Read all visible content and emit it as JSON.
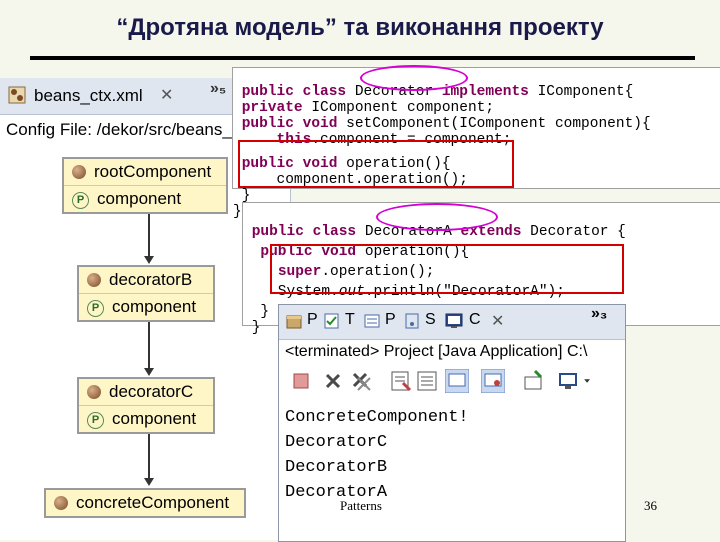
{
  "slide": {
    "title": "“Дротяна модель” та виконання проекту",
    "footer_left": "Patterns",
    "page_number": "36"
  },
  "beans_editor": {
    "tab_label": "beans_ctx.xml",
    "tab_close": "✕",
    "tab_overflow": "»₅",
    "config_file": "Config File: /dekor/src/beans_ctx.xml",
    "nodes": [
      {
        "bean": "rootComponent",
        "property": "component"
      },
      {
        "bean": "decoratorB",
        "property": "component"
      },
      {
        "bean": "decoratorC",
        "property": "component"
      },
      {
        "bean": "concreteComponent",
        "property": ""
      }
    ],
    "property_badge": "P"
  },
  "code1": {
    "lines": [
      [
        "public class ",
        "Decorator",
        " implements IComponent{"
      ],
      [
        " private IComponent component;"
      ],
      [
        " public void setComponent(IComponent component){"
      ],
      [
        "     this.component = component;"
      ],
      [
        " public void operation(){"
      ],
      [
        "     component.operation();"
      ],
      [
        " }"
      ],
      [
        "}"
      ]
    ]
  },
  "code2": {
    "lines": [
      "public class DecoratorA extends Decorator {",
      " public void operation(){",
      "     super.operation();",
      "     System.out.println(\"DecoratorA\");",
      " }",
      "}"
    ]
  },
  "console": {
    "tabs": [
      "P",
      "T",
      "P",
      "S",
      "C"
    ],
    "tab_close": "✕",
    "tab_overflow": "»₃",
    "status": "<terminated> Project [Java Application] C:\\",
    "output": [
      "ConcreteComponent!",
      "DecoratorC",
      "DecoratorB",
      "DecoratorA"
    ]
  },
  "colors": {
    "keyword": "#7f0055",
    "highlight_frame": "#d40000",
    "oval_mark": "#d400d4",
    "bean_fill": "#fff6c8"
  }
}
